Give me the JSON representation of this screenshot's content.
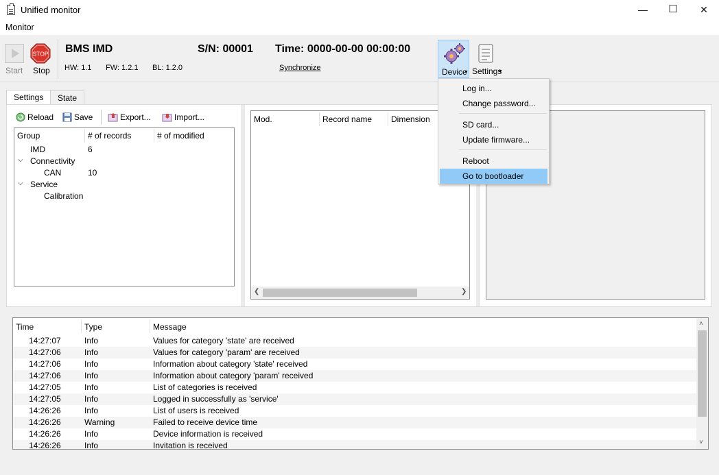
{
  "window": {
    "title": "Unified monitor",
    "minimize_glyph": "—",
    "maximize_glyph": "☐",
    "close_glyph": "✕"
  },
  "menubar": {
    "monitor": "Monitor"
  },
  "toolbar": {
    "start_label": "Start",
    "stop_label": "Stop",
    "stop_sign_text": "STOP",
    "device_name": "BMS IMD",
    "serial": "S/N: 00001",
    "time": "Time: 0000-00-00 00:00:00",
    "hw": "HW: 1.1",
    "fw": "FW: 1.2.1",
    "bl": "BL: 1.2.0",
    "synchronize": "Synchronize",
    "device_label": "Device",
    "settings_label": "Settings"
  },
  "tabs": [
    {
      "label": "Settings",
      "active": true
    },
    {
      "label": "State",
      "active": false
    }
  ],
  "settings_toolbar": {
    "reload": "Reload",
    "save": "Save",
    "export": "Export...",
    "import": "Import..."
  },
  "tree": {
    "columns": [
      "Group",
      "# of records",
      "# of modified"
    ],
    "rows": [
      {
        "name": "IMD",
        "records": "6",
        "modified": ""
      },
      {
        "name": "Connectivity",
        "records": "",
        "modified": ""
      },
      {
        "name": "CAN",
        "records": "10",
        "modified": ""
      },
      {
        "name": "Service",
        "records": "",
        "modified": ""
      },
      {
        "name": "Calibration",
        "records": "",
        "modified": ""
      }
    ]
  },
  "records_table": {
    "columns": [
      "Mod.",
      "Record name",
      "Dimension"
    ]
  },
  "log": {
    "columns": [
      "Time",
      "Type",
      "Message"
    ],
    "rows": [
      {
        "time": "14:27:07",
        "type": "Info",
        "message": "Values for category 'state' are received"
      },
      {
        "time": "14:27:06",
        "type": "Info",
        "message": "Values for category 'param' are received"
      },
      {
        "time": "14:27:06",
        "type": "Info",
        "message": "Information about category 'state' received"
      },
      {
        "time": "14:27:06",
        "type": "Info",
        "message": "Information about category 'param' received"
      },
      {
        "time": "14:27:05",
        "type": "Info",
        "message": "List of categories is received"
      },
      {
        "time": "14:27:05",
        "type": "Info",
        "message": "Logged in successfully as 'service'"
      },
      {
        "time": "14:26:26",
        "type": "Info",
        "message": "List of users is received"
      },
      {
        "time": "14:26:26",
        "type": "Warning",
        "message": "Failed to receive device time"
      },
      {
        "time": "14:26:26",
        "type": "Info",
        "message": "Device information is received"
      },
      {
        "time": "14:26:26",
        "type": "Info",
        "message": "Invitation is received"
      }
    ]
  },
  "device_menu": {
    "items": [
      {
        "label": "Log in..."
      },
      {
        "label": "Change password..."
      },
      {
        "label": "SD card..."
      },
      {
        "label": "Update firmware..."
      },
      {
        "label": "Reboot"
      },
      {
        "label": "Go to bootloader",
        "highlighted": true
      }
    ]
  },
  "colors": {
    "menu_highlight": "#91c9f7",
    "device_button_active": "#cce4f7",
    "stop_red": "#d9342b"
  }
}
